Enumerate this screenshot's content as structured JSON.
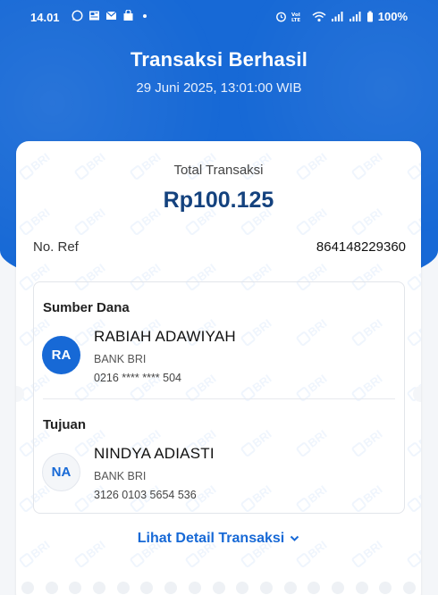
{
  "status_bar": {
    "time": "14.01",
    "battery": "100%"
  },
  "header": {
    "title": "Transaksi Berhasil",
    "datetime": "29 Juni 2025, 13:01:00 WIB"
  },
  "receipt": {
    "total_label": "Total Transaksi",
    "total_value": "Rp100.125",
    "ref_label": "No. Ref",
    "ref_value": "864148229360",
    "source": {
      "section_title": "Sumber Dana",
      "initials": "RA",
      "name": "RABIAH ADAWIYAH",
      "bank": "BANK BRI",
      "account": "0216 **** **** 504"
    },
    "destination": {
      "section_title": "Tujuan",
      "initials": "NA",
      "name": "NINDYA ADIASTI",
      "bank": "BANK BRI",
      "account": "3126 0103 5654 536"
    },
    "detail_link": "Lihat Detail Transaksi"
  },
  "watermark_text": "BRI",
  "colors": {
    "primary_blue": "#1769d6",
    "total_text": "#14427e"
  }
}
